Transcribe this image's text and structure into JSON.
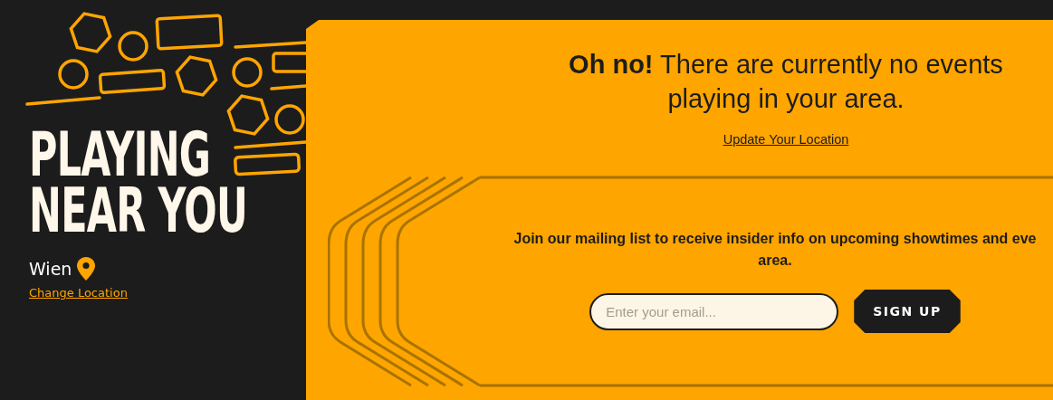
{
  "sidebar": {
    "title_lines": [
      "PLAYING",
      "NEAR YOU"
    ],
    "city": "Wien",
    "change_location": "Change Location"
  },
  "notice": {
    "message": "**Oh no!** There are currently no events playing in your area.",
    "update_location": "Update Your Location"
  },
  "mailing": {
    "text_lines": [
      "Join our mailing list to receive insider info on upcoming showtimes and eve",
      "area."
    ],
    "email_placeholder": "Enter your email...",
    "button": "SIGN UP"
  }
}
